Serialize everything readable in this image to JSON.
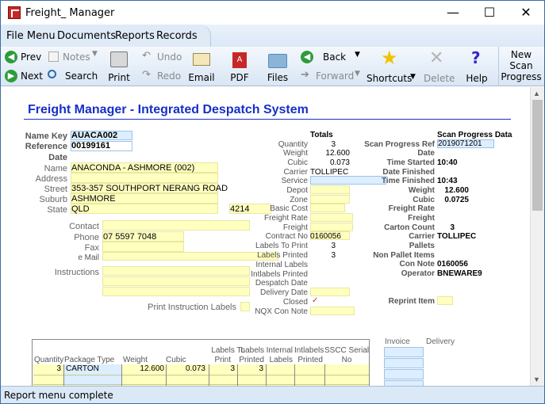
{
  "window": {
    "title": "Freight_ Manager",
    "minimize": "—",
    "maximize": "☐",
    "close": "✕"
  },
  "menu": [
    "File Menu",
    "Documents",
    "Reports",
    "Records"
  ],
  "toolbar": {
    "prev": "Prev",
    "next": "Next",
    "notes": "Notes",
    "search": "Search",
    "print": "Print",
    "undo": "Undo",
    "redo": "Redo",
    "email": "Email",
    "pdf": "PDF",
    "files": "Files",
    "back": "Back",
    "forward": "Forward",
    "shortcuts": "Shortcuts",
    "delete": "Delete",
    "help": "Help",
    "new_scan": [
      "New",
      "Scan",
      "Progress"
    ]
  },
  "report": {
    "title": "Freight Manager - Integrated Despatch System",
    "left": {
      "name_key_label": "Name Key",
      "name_key": "AUACA002",
      "reference_label": "Reference",
      "reference": "00199161",
      "date_label": "Date",
      "name_label": "Name",
      "name": "ANACONDA - ASHMORE (002)",
      "address_label": "Address",
      "street_label": "Street",
      "street": "353-357 SOUTHPORT NERANG ROAD",
      "suburb_label": "Suburb",
      "suburb": "ASHMORE",
      "state_label": "State",
      "state": "QLD",
      "postcode": "4214",
      "contact_label": "Contact",
      "phone_label": "Phone",
      "phone": "07 5597 7048",
      "fax_label": "Fax",
      "email_label": "e Mail",
      "instructions_label": "Instructions",
      "print_instr_label": "Print Instruction Labels"
    },
    "totals": {
      "heading": "Totals",
      "quantity_label": "Quantity",
      "quantity": "3",
      "weight_label": "Weight",
      "weight": "12.600",
      "cubic_label": "Cubic",
      "cubic": "0.073",
      "carrier_label": "Carrier",
      "carrier": "TOLLIPEC",
      "service_label": "Service",
      "depot_label": "Depot",
      "zone_label": "Zone",
      "basic_cost_label": "Basic Cost",
      "freight_rate_label": "Freight Rate",
      "freight_label": "Freight",
      "contract_no_label": "Contract No",
      "contract_no": "0160056",
      "labels_to_print_label": "Labels To Print",
      "labels_to_print": "3",
      "labels_printed_label": "Labels Printed",
      "labels_printed": "3",
      "internal_labels_label": "Internal Labels",
      "intlabels_printed_label": "Intlabels Printed",
      "despatch_date_label": "Despatch Date",
      "delivery_date_label": "Delivery Date",
      "closed_label": "Closed",
      "closed": "✓",
      "nqx_label": "NQX Con Note"
    },
    "scan": {
      "heading": "Scan Progress Data",
      "ref_label": "Scan Progress Ref",
      "ref": "2019071201",
      "date_label": "Date",
      "time_started_label": "Time Started",
      "time_started": "10:40",
      "date_finished_label": "Date Finished",
      "time_finished_label": "Time Finished",
      "time_finished": "10:43",
      "weight_label": "Weight",
      "weight": "12.600",
      "cubic_label": "Cubic",
      "cubic": "0.0725",
      "freight_rate_label": "Freight Rate",
      "freight_label": "Freight",
      "carton_count_label": "Carton Count",
      "carton_count": "3",
      "carrier_label": "Carrier",
      "carrier": "TOLLIPEC",
      "pallets_label": "Pallets",
      "non_pallet_label": "Non Pallet Items",
      "con_note_label": "Con Note",
      "con_note": "0160056",
      "operator_label": "Operator",
      "operator": "BNEWARE9",
      "reprint_label": "Reprint Item"
    },
    "grid": {
      "headers": [
        {
          "l1": "",
          "l2": "Quantity"
        },
        {
          "l1": "",
          "l2": "Package Type"
        },
        {
          "l1": "",
          "l2": "Weight"
        },
        {
          "l1": "",
          "l2": "Cubic"
        },
        {
          "l1": "Labels To",
          "l2": "Print"
        },
        {
          "l1": "Labels",
          "l2": "Printed"
        },
        {
          "l1": "Internal",
          "l2": "Labels"
        },
        {
          "l1": "Intlabels",
          "l2": "Printed"
        },
        {
          "l1": "SSCC Serial",
          "l2": "No"
        }
      ],
      "row": {
        "quantity": "3",
        "package": "CARTON",
        "weight": "12.600",
        "cubic": "0.073",
        "to_print": "3",
        "printed": "3"
      },
      "invoice_label": "Invoice",
      "delivery_label": "Delivery"
    }
  },
  "status": "Report menu complete"
}
